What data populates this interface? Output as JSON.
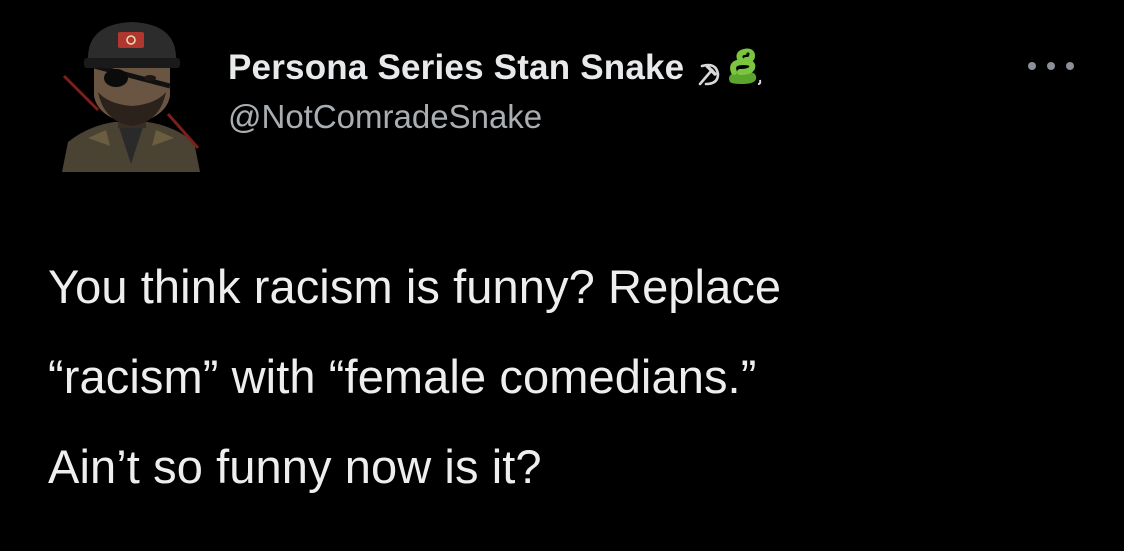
{
  "tweet": {
    "author": {
      "display_name": "Persona Series Stan Snake",
      "handle": "@NotComradeSnake",
      "avatar_icon": "soldier-eyepatch-avatar",
      "name_emojis": [
        "hammer-sickle-icon",
        "snake-icon"
      ]
    },
    "more_icon": "more-horizontal-icon",
    "text_lines": [
      "You think racism is funny? Replace",
      "“racism” with “female comedians.”",
      "Ain’t so funny now is it?"
    ]
  },
  "colors": {
    "background": "#000000",
    "text": "#e7e9ea",
    "secondary": "#a9aeb3",
    "snake_green": "#7cc63f"
  }
}
